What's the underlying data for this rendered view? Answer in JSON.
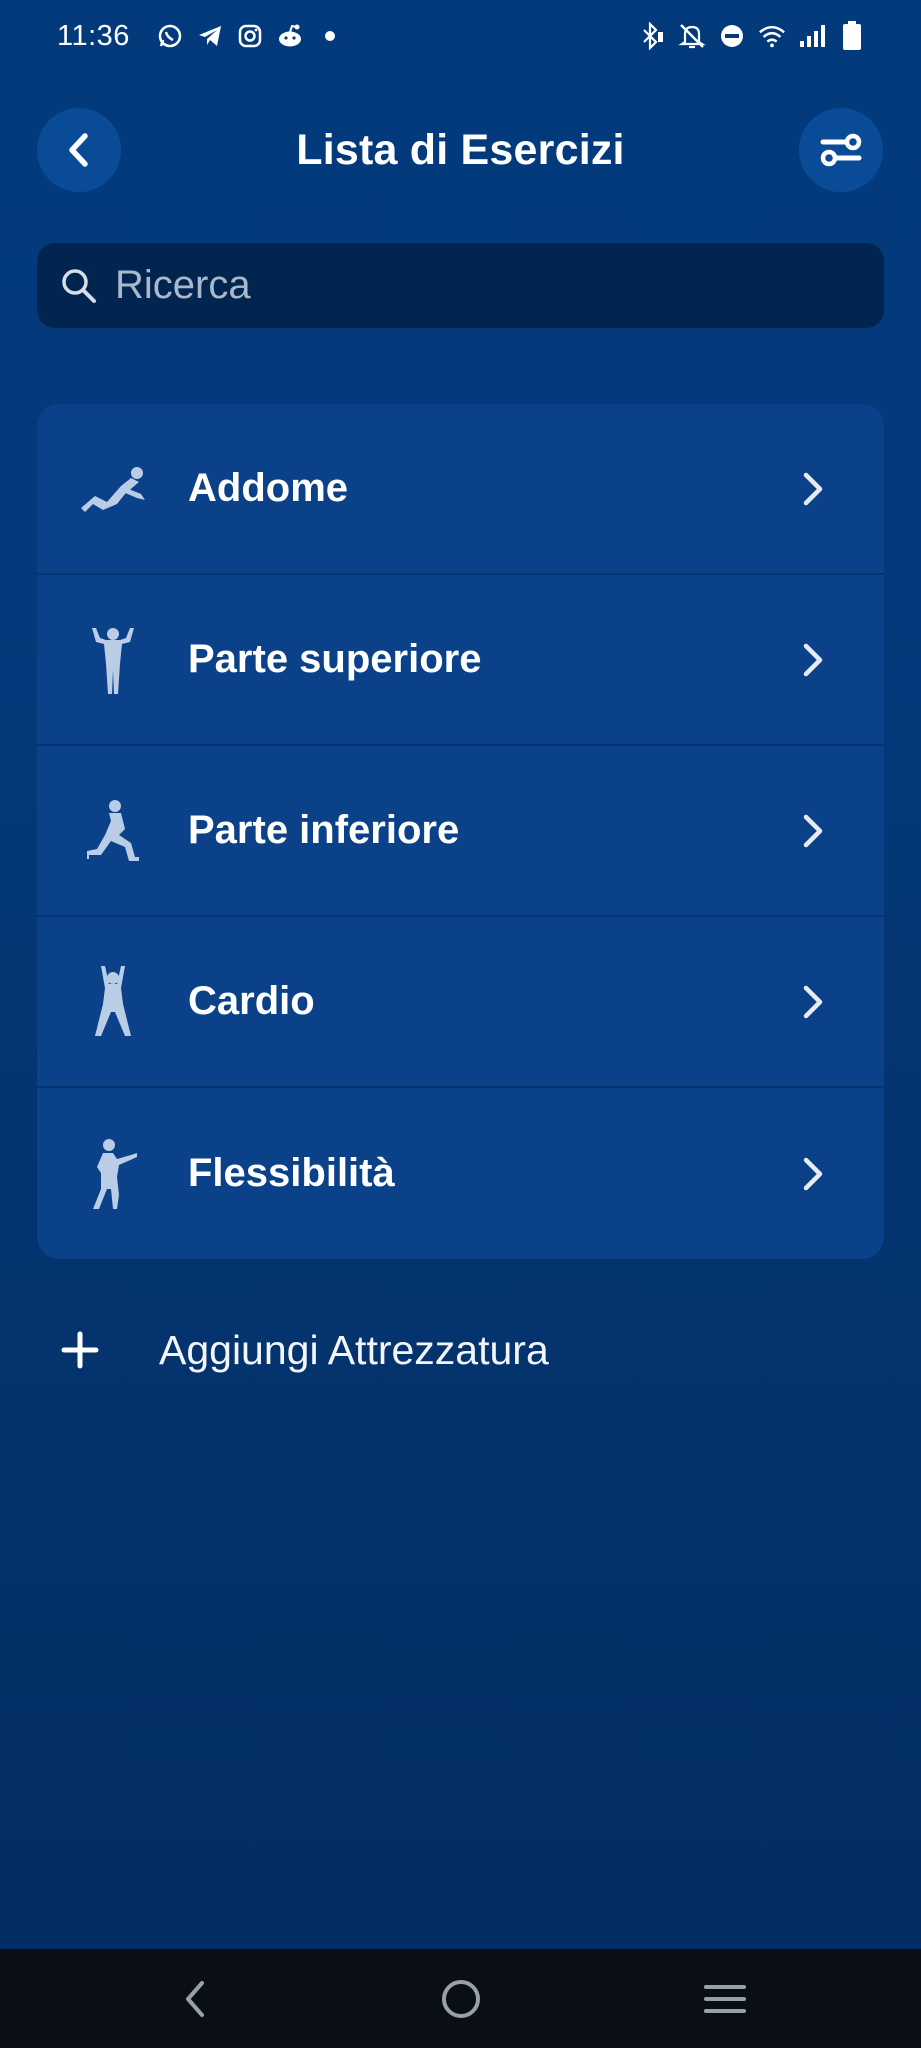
{
  "status_bar": {
    "time": "11:36",
    "left_icons": [
      "whatsapp-icon",
      "telegram-icon",
      "instagram-icon",
      "reddit-icon",
      "dot-icon"
    ],
    "right_icons": [
      "bluetooth-icon",
      "mute-icon",
      "dnd-icon",
      "wifi-icon",
      "signal-icon",
      "battery-icon"
    ]
  },
  "header": {
    "title": "Lista di Esercizi",
    "back_icon": "chevron-left-icon",
    "filter_icon": "sliders-icon"
  },
  "search": {
    "placeholder": "Ricerca",
    "value": ""
  },
  "categories": [
    {
      "label": "Addome",
      "icon": "situp-figure-icon"
    },
    {
      "label": "Parte superiore",
      "icon": "flex-figure-icon"
    },
    {
      "label": "Parte inferiore",
      "icon": "lunge-figure-icon"
    },
    {
      "label": "Cardio",
      "icon": "jumping-figure-icon"
    },
    {
      "label": "Flessibilità",
      "icon": "stretch-figure-icon"
    }
  ],
  "add_equipment": {
    "label": "Aggiungi Attrezzatura",
    "icon": "plus-icon"
  },
  "nav_bar": {
    "items": [
      "back-nav-icon",
      "home-nav-icon",
      "recents-nav-icon"
    ]
  },
  "colors": {
    "background": "#04397b",
    "card": "#0a4188",
    "search_bg": "#02254f",
    "header_button": "#0a4b97",
    "figure": "#b9cde6",
    "nav_bar": "#0a0f16"
  }
}
